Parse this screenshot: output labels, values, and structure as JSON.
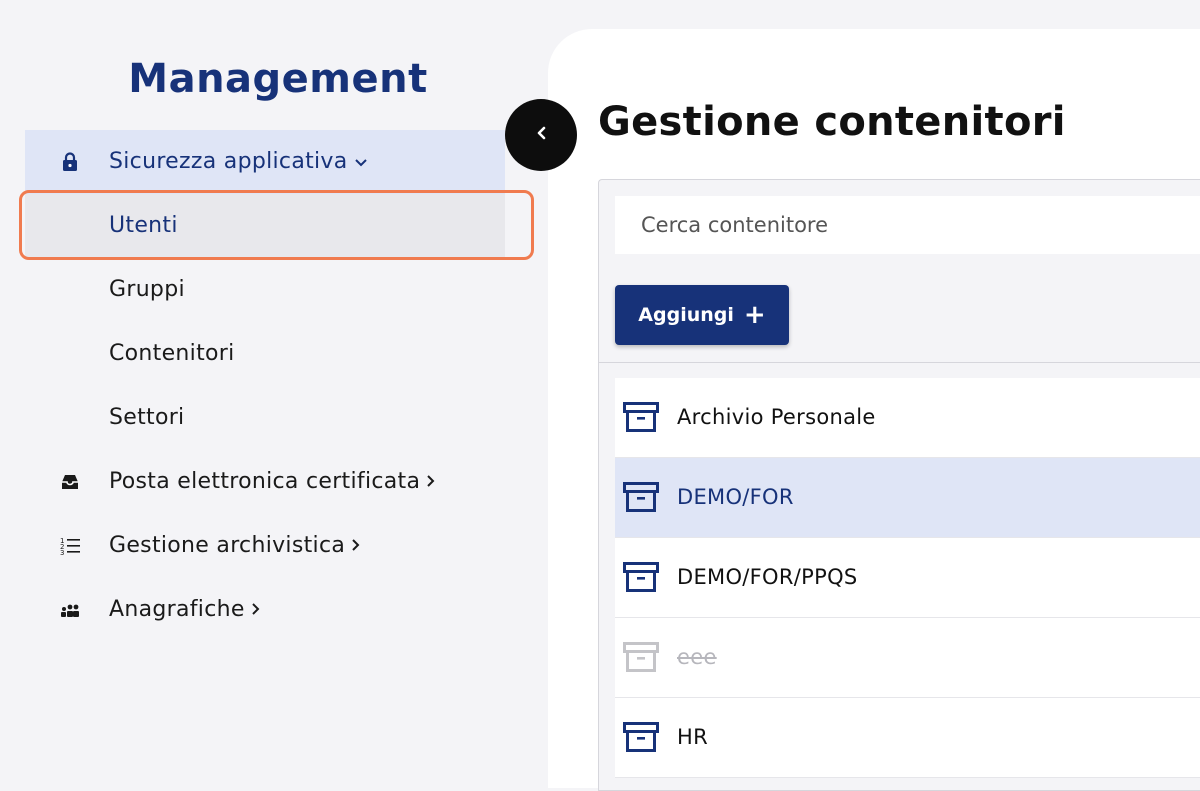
{
  "sidebar": {
    "title": "Management",
    "items": [
      {
        "label": "Sicurezza applicativa",
        "icon": "lock-icon",
        "chevron": "down"
      },
      {
        "label": "Utenti"
      },
      {
        "label": "Gruppi"
      },
      {
        "label": "Contenitori"
      },
      {
        "label": "Settori"
      },
      {
        "label": "Posta elettronica certificata",
        "icon": "inbox-icon",
        "chevron": "right"
      },
      {
        "label": "Gestione archivistica",
        "icon": "numbered-list-icon",
        "chevron": "right"
      },
      {
        "label": "Anagrafiche",
        "icon": "people-icon",
        "chevron": "right"
      }
    ]
  },
  "main": {
    "title": "Gestione contenitori",
    "search": {
      "placeholder": "Cerca contenitore",
      "value": ""
    },
    "add_button": {
      "label": "Aggiungi",
      "icon": "plus-icon"
    },
    "containers": [
      {
        "name": "Archivio Personale",
        "state": "normal"
      },
      {
        "name": "DEMO/FOR",
        "state": "selected"
      },
      {
        "name": "DEMO/FOR/PPQS",
        "state": "normal"
      },
      {
        "name": "eee",
        "state": "disabled"
      },
      {
        "name": "HR",
        "state": "normal"
      }
    ]
  },
  "colors": {
    "accent": "#173279",
    "highlight": "#dfe5f6",
    "focus_ring": "#f07b4f"
  }
}
